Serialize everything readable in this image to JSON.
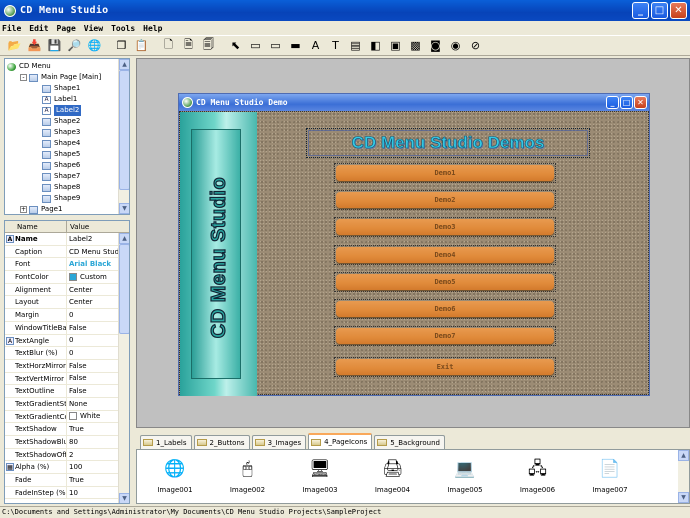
{
  "window": {
    "title": "CD Menu Studio"
  },
  "menubar": {
    "items": [
      "File",
      "Edit",
      "Page",
      "View",
      "Tools",
      "Help"
    ]
  },
  "toolbar": {
    "icons": [
      "open-folder-icon",
      "import-icon",
      "save-icon",
      "find-icon",
      "preview-icon",
      "copy-icon",
      "paste-icon",
      "new-page-icon",
      "page-icon",
      "page-settings-icon",
      "pointer-tool-icon",
      "button-tool-icon",
      "rectangle-tool-icon",
      "image-tool-icon",
      "text-tool-icon",
      "label-tool-icon",
      "link-tool-icon",
      "shape-tool-icon",
      "box-tool-icon",
      "picture-tool-icon",
      "media-tool-icon",
      "radio-tool-icon",
      "web-tool-icon"
    ]
  },
  "tree": {
    "items": [
      {
        "label": "CD Menu",
        "level": 0,
        "icon": "root",
        "expander": ""
      },
      {
        "label": "Main Page [Main]",
        "level": 1,
        "icon": "page",
        "expander": "-"
      },
      {
        "label": "Shape1",
        "level": 2,
        "icon": "shape",
        "expander": ""
      },
      {
        "label": "Label1",
        "level": 2,
        "icon": "label",
        "expander": ""
      },
      {
        "label": "Label2",
        "level": 2,
        "icon": "label",
        "expander": "",
        "selected": true
      },
      {
        "label": "Shape2",
        "level": 2,
        "icon": "shape",
        "expander": ""
      },
      {
        "label": "Shape3",
        "level": 2,
        "icon": "shape",
        "expander": ""
      },
      {
        "label": "Shape4",
        "level": 2,
        "icon": "shape",
        "expander": ""
      },
      {
        "label": "Shape5",
        "level": 2,
        "icon": "shape",
        "expander": ""
      },
      {
        "label": "Shape6",
        "level": 2,
        "icon": "shape",
        "expander": ""
      },
      {
        "label": "Shape7",
        "level": 2,
        "icon": "shape",
        "expander": ""
      },
      {
        "label": "Shape8",
        "level": 2,
        "icon": "shape",
        "expander": ""
      },
      {
        "label": "Shape9",
        "level": 2,
        "icon": "shape",
        "expander": ""
      },
      {
        "label": "Page1",
        "level": 1,
        "icon": "page",
        "expander": "+"
      }
    ]
  },
  "properties": {
    "header": {
      "name": "Name",
      "value": "Value"
    },
    "rows": [
      {
        "name": "Name",
        "value": "Label2",
        "bold": true,
        "icon": "A"
      },
      {
        "name": "Caption",
        "value": "CD Menu Studio"
      },
      {
        "name": "Font",
        "value": "Arial Black",
        "font": true
      },
      {
        "name": "FontColor",
        "value": "Custom",
        "swatch": "#2aa6d6"
      },
      {
        "name": "Alignment",
        "value": "Center"
      },
      {
        "name": "Layout",
        "value": "Center"
      },
      {
        "name": "Margin",
        "value": "0"
      },
      {
        "name": "WindowTitleBar",
        "value": "False"
      },
      {
        "name": "TextAngle",
        "value": "0",
        "icon": "A"
      },
      {
        "name": "TextBlur (%)",
        "value": "0"
      },
      {
        "name": "TextHorzMirror",
        "value": "False"
      },
      {
        "name": "TextVertMirror",
        "value": "False"
      },
      {
        "name": "TextOutline",
        "value": "False"
      },
      {
        "name": "TextGradientStyle",
        "value": "None"
      },
      {
        "name": "TextGradientColor",
        "value": "White",
        "swatch": "#ffffff"
      },
      {
        "name": "TextShadow",
        "value": "True"
      },
      {
        "name": "TextShadowBlur",
        "value": "80"
      },
      {
        "name": "TextShadowOffset",
        "value": "2"
      },
      {
        "name": "Alpha (%)",
        "value": "100",
        "icon": "▦"
      },
      {
        "name": "Fade",
        "value": "True"
      },
      {
        "name": "FadeInStep (%)",
        "value": "10"
      }
    ]
  },
  "design_window": {
    "title": "CD Menu Studio Demo",
    "sidebar_label": "CD Menu Studio",
    "menu_title": "CD Menu Studio Demos",
    "buttons": [
      "Demo1",
      "Demo2",
      "Demo3",
      "Demo4",
      "Demo5",
      "Demo6",
      "Demo7",
      "Exit"
    ]
  },
  "tabs": [
    {
      "label": "1_Labels"
    },
    {
      "label": "2_Buttons"
    },
    {
      "label": "3_Images"
    },
    {
      "label": "4_PageIcons",
      "active": true
    },
    {
      "label": "5_Background"
    }
  ],
  "gallery": {
    "items": [
      {
        "label": "Image001",
        "icon": "globe-icon",
        "glyph": "🌐"
      },
      {
        "label": "Image002",
        "icon": "globe-cursor-icon",
        "glyph": "🖱"
      },
      {
        "label": "Image003",
        "icon": "computers-icon",
        "glyph": "🖥"
      },
      {
        "label": "Image004",
        "icon": "printer-icon",
        "glyph": "🖨"
      },
      {
        "label": "Image005",
        "icon": "network-computer-icon",
        "glyph": "💻"
      },
      {
        "label": "Image006",
        "icon": "network-icon",
        "glyph": "🖧"
      },
      {
        "label": "Image007",
        "icon": "document-icon",
        "glyph": "📄"
      }
    ]
  },
  "status": {
    "path": "C:\\Documents and Settings\\Administrator\\My Documents\\CD Menu Studio Projects\\SampleProject"
  }
}
